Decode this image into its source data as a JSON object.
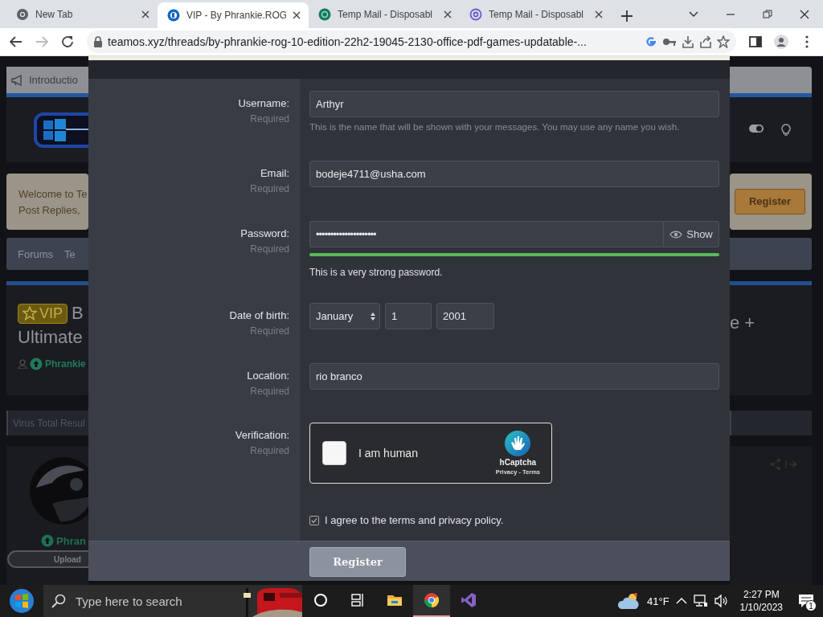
{
  "browser": {
    "tabs": [
      {
        "kind": "chrome",
        "title": "New Tab",
        "selected": false
      },
      {
        "kind": "site",
        "title": "VIP - By Phrankie.ROG",
        "selected": true
      },
      {
        "kind": "tempmail",
        "title": "Temp Mail - Disposabl",
        "selected": false
      },
      {
        "kind": "at",
        "title": "Temp Mail - Disposabl",
        "selected": false
      }
    ],
    "url": "teamos.xyz/threads/by-phrankie-rog-10-edition-22h2-19045-2130-office-pdf-games-updatable-..."
  },
  "page_behind": {
    "left": {
      "notice": "Introductio",
      "welcome": [
        "Welcome to Te",
        "Post Replies,"
      ],
      "crumbs": [
        "Forums",
        "Te"
      ],
      "badge": "VIP",
      "title": [
        "B",
        "Ultimate"
      ],
      "author": "Phrankie",
      "tab": "Virus Total Resul",
      "poster": "Phran",
      "upload": "Upload"
    },
    "right": {
      "register": "Register",
      "title": "e +"
    }
  },
  "dialog": {
    "fields": [
      {
        "kind": "text",
        "label": "Username:",
        "note": "Required",
        "value": "Arthyr",
        "help": "This is the name that will be shown with your messages. You may use any name you wish."
      },
      {
        "kind": "text",
        "label": "Email:",
        "note": "Required",
        "value": "bodeje4711@usha.com"
      },
      {
        "kind": "password",
        "label": "Password:",
        "note": "Required",
        "value": "•••••••••••••••••••••",
        "toggle": "Show",
        "strength": {
          "level": 1,
          "text": "This is a very strong password."
        }
      },
      {
        "kind": "date",
        "label": "Date of birth:",
        "note": "Required",
        "month": "January",
        "day": "1",
        "year": "2001"
      },
      {
        "kind": "text",
        "label": "Location:",
        "note": "Required",
        "value": "rio branco"
      },
      {
        "kind": "captcha",
        "label": "Verification:",
        "note": "Required",
        "checked": false,
        "text": "I am human",
        "brand": "hCaptcha",
        "links": "Privacy - Terms"
      }
    ],
    "agree": {
      "checked": true,
      "text": "I agree to the terms and privacy policy."
    },
    "submit": "Register"
  },
  "taskbar": {
    "search_placeholder": "Type here to search",
    "apps": [
      {
        "kind": "cortana",
        "selected": false
      },
      {
        "kind": "taskview",
        "selected": false
      },
      {
        "kind": "explorer",
        "selected": false
      },
      {
        "kind": "chrome",
        "selected": true
      },
      {
        "kind": "studio",
        "selected": false
      }
    ],
    "temperature": "41°F",
    "time": "2:27 PM",
    "date": "1/10/2023",
    "notifications": "1"
  }
}
